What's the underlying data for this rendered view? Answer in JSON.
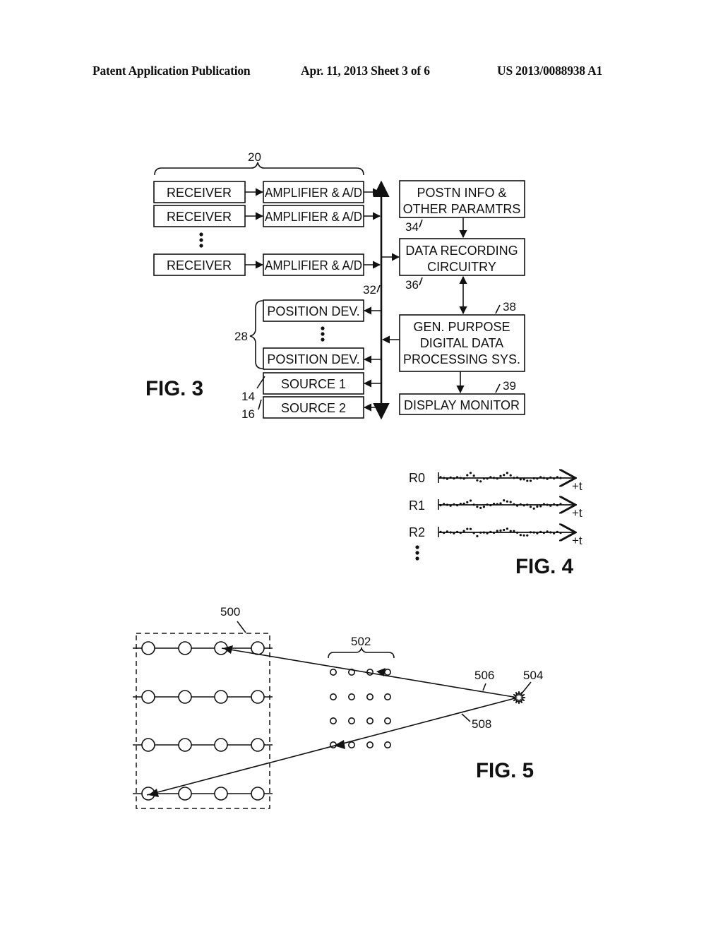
{
  "header": {
    "left": "Patent Application Publication",
    "center": "Apr. 11, 2013  Sheet 3 of 6",
    "right": "US 2013/0088938 A1"
  },
  "fig3": {
    "title": "FIG. 3",
    "ref_receivers_group": "20",
    "receivers": [
      {
        "receiver": "RECEIVER",
        "amplifier": "AMPLIFIER & A/D"
      },
      {
        "receiver": "RECEIVER",
        "amplifier": "AMPLIFIER & A/D"
      },
      {
        "receiver": "RECEIVER",
        "amplifier": "AMPLIFIER & A/D"
      }
    ],
    "ellipsis": "⋮",
    "bus_ref": "32",
    "position_group_ref": "28",
    "position_devices": [
      "POSITION DEV.",
      "POSITION DEV."
    ],
    "sources": [
      {
        "label": "SOURCE 1",
        "ref": "14"
      },
      {
        "label": "SOURCE 2",
        "ref": "16"
      }
    ],
    "postn_info": {
      "line1": "POSTN INFO &",
      "line2": "OTHER PARAMTRS",
      "ref": "34"
    },
    "data_recording": {
      "line1": "DATA RECORDING",
      "line2": "CIRCUITRY",
      "ref": "36"
    },
    "gen_purpose": {
      "line1": "GEN. PURPOSE",
      "line2": "DIGITAL DATA",
      "line3": "PROCESSING SYS.",
      "ref": "38"
    },
    "display": {
      "label": "DISPLAY MONITOR",
      "ref": "39"
    }
  },
  "fig4": {
    "title": "FIG. 4",
    "traces": [
      {
        "label": "R0",
        "axis": "+t"
      },
      {
        "label": "R1",
        "axis": "+t"
      },
      {
        "label": "R2",
        "axis": "+t"
      }
    ],
    "ellipsis": "⋮"
  },
  "fig5": {
    "title": "FIG. 5",
    "receiver_array_ref": "500",
    "sub_array_ref": "502",
    "source_ref": "504",
    "ray_down_ref": "506",
    "ray_up_ref": "508"
  }
}
